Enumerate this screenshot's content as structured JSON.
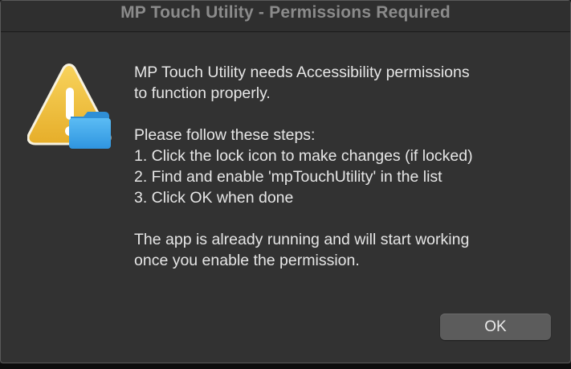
{
  "window": {
    "title": "MP Touch Utility - Permissions Required"
  },
  "icon": {
    "name": "warning-folder-icon",
    "colors": {
      "triangle": "#f2c443",
      "folder": "#3aa6ea",
      "mark": "#ffffff"
    }
  },
  "message": {
    "line1": "MP Touch Utility needs Accessibility permissions",
    "line2": "to function properly.",
    "steps_header": "Please follow these steps:",
    "step1": "1. Click the lock icon to make changes (if locked)",
    "step2": "2. Find and enable 'mpTouchUtility' in the list",
    "step3": "3. Click OK when done",
    "footer1": "The app is already running and will start working",
    "footer2": "once you enable the permission."
  },
  "buttons": {
    "ok_label": "OK"
  }
}
